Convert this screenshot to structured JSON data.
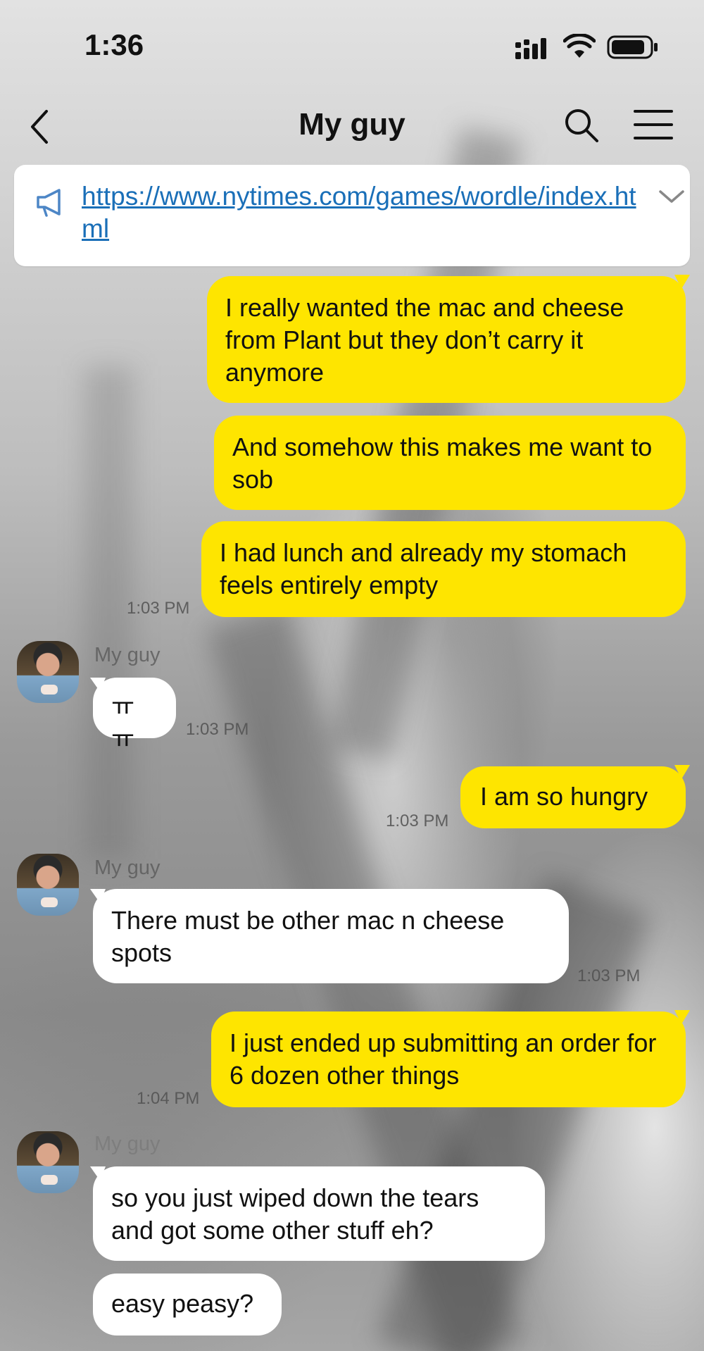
{
  "status_bar": {
    "time": "1:36"
  },
  "header": {
    "title": "My guy"
  },
  "notice": {
    "link": "https://www.nytimes.com/games/wordle/index.html"
  },
  "messages": [
    {
      "from": "me",
      "text": "I really wanted the mac and cheese from Plant but they don’t carry it anymore"
    },
    {
      "from": "me",
      "text": "And somehow this makes me want to sob"
    },
    {
      "from": "me",
      "text": "I had lunch and already my stomach feels entirely empty",
      "time": "1:03 PM"
    },
    {
      "from": "them",
      "sender": "My guy",
      "text": "ㅠㅠ",
      "time": "1:03 PM"
    },
    {
      "from": "me",
      "text": "I am so hungry",
      "time": "1:03 PM"
    },
    {
      "from": "them",
      "sender": "My guy",
      "text": "There must be other mac n cheese spots",
      "time": "1:03 PM"
    },
    {
      "from": "me",
      "text": "I just ended up submitting an order for 6 dozen other things",
      "time": "1:04 PM"
    },
    {
      "from": "them",
      "sender": "My guy",
      "text": "so you just wiped down the tears and got some other stuff eh?"
    },
    {
      "from": "them",
      "text": "easy peasy?"
    }
  ],
  "colors": {
    "my_bubble": "#fee500",
    "their_bubble": "#ffffff",
    "link": "#1a6fb8"
  },
  "icons": [
    "back-icon",
    "search-icon",
    "menu-icon",
    "megaphone-icon",
    "chevron-down-icon",
    "signal-icon",
    "wifi-icon",
    "battery-icon"
  ]
}
